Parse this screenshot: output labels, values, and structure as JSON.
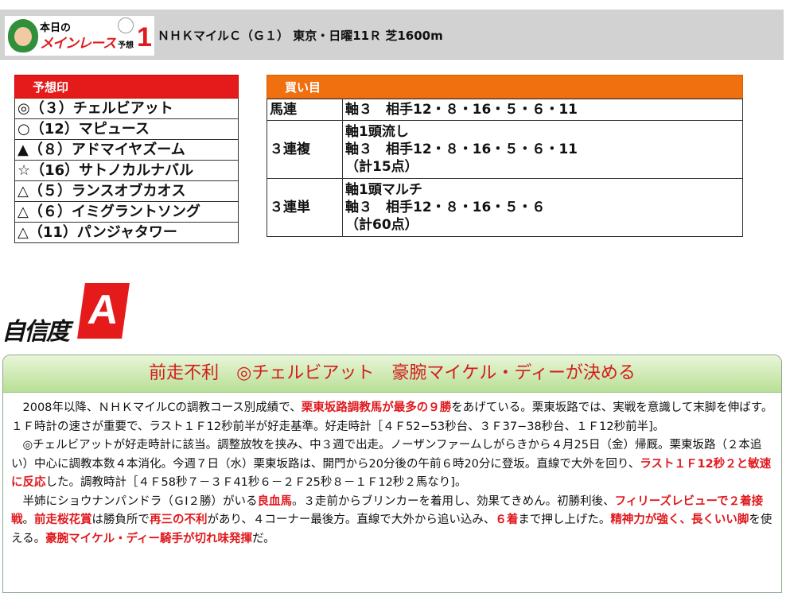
{
  "header": {
    "logo": {
      "line1": "本日の",
      "line2": "メインレース",
      "line3": "予想",
      "number": "1"
    },
    "race_title": "ＮＨＫマイルＣ（Ｇ１） 東京・日曜11Ｒ 芝1600m"
  },
  "marks": {
    "header": "予想印",
    "rows": [
      "◎（３）チェルビアット",
      "○（12）マピュース",
      "▲（８）アドマイヤズーム",
      "☆（16）サトノカルナバル",
      "△（５）ランスオブカオス",
      "△（６）イミグラントソング",
      "△（11）パンジャタワー"
    ]
  },
  "bets": {
    "header": "買い目",
    "rows": [
      {
        "type": "馬連",
        "lines": [
          "軸３　相手12・８・16・５・６・11"
        ]
      },
      {
        "type": "３連複",
        "lines": [
          "軸1頭流し",
          "軸３　相手12・８・16・５・６・11",
          "（計15点）"
        ]
      },
      {
        "type": "３連単",
        "lines": [
          "軸1頭マルチ",
          "軸３　相手12・８・16・５・６",
          "（計60点）"
        ]
      }
    ]
  },
  "confidence": {
    "label": "自信度",
    "grade": "A"
  },
  "article": {
    "title": "前走不利　◎チェルビアット　豪腕マイケル・ディーが決める",
    "paragraphs": [
      [
        {
          "t": "2008年以降、ＮＨＫマイルCの調教コース別成績で、"
        },
        {
          "t": "栗東坂路調教馬が最多の９勝",
          "hl": true
        },
        {
          "t": "をあげている。栗東坂路では、実戦を意識して末脚を伸ばす。１Ｆ時計の速さが重要で、ラスト１Ｆ12秒前半が好走基準。好走時計［４Ｆ52−53秒台、３Ｆ37−38秒台、１Ｆ12秒前半]。"
        }
      ],
      [
        {
          "t": "◎チェルビアットが好走時計に該当。調整放牧を挟み、中３週で出走。ノーザンファームしがらきから４月25日（金）帰厩。栗東坂路（２本追い）中心に調教本数４本消化。今週７日（水）栗東坂路は、開門から20分後の午前６時20分に登坂。直線で大外を回り、"
        },
        {
          "t": "ラスト１Ｆ12秒２と敏速に反応",
          "hl": true
        },
        {
          "t": "した。調教時計［４Ｆ58秒７－３Ｆ41秒６－２Ｆ25秒８－１Ｆ12秒２馬なり]。"
        }
      ],
      [
        {
          "t": "半姉にショウナンパンドラ（ＧⅠ２勝）がいる"
        },
        {
          "t": "良血馬",
          "hl": true
        },
        {
          "t": "。３走前からブリンカーを着用し、効果てきめん。初勝利後、"
        },
        {
          "t": "フィリーズレビューで２着接戦",
          "hl": true
        },
        {
          "t": "。"
        },
        {
          "t": "前走桜花賞",
          "hl": true
        },
        {
          "t": "は勝負所で"
        },
        {
          "t": "再三の不利",
          "hl": true
        },
        {
          "t": "があり、４コーナー最後方。直線で大外から追い込み、"
        },
        {
          "t": "６着",
          "hl": true
        },
        {
          "t": "まで押し上げた。"
        },
        {
          "t": "精神力が強く、長くいい脚",
          "hl": true
        },
        {
          "t": "を使える。"
        },
        {
          "t": "豪腕マイケル・ディー騎手が切れ味発揮",
          "hl": true
        },
        {
          "t": "だ。"
        }
      ]
    ]
  }
}
